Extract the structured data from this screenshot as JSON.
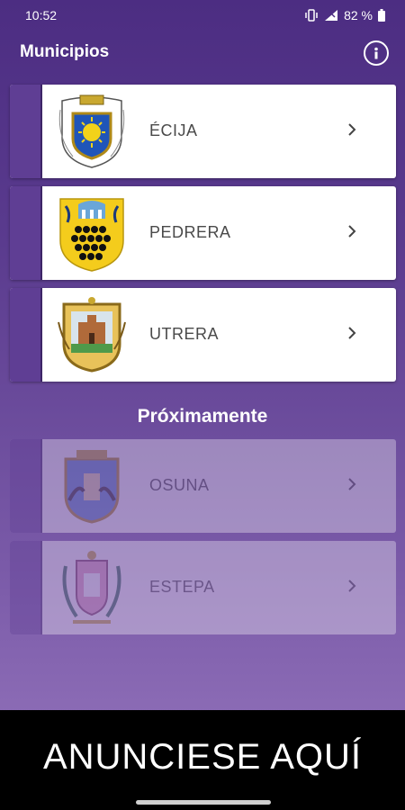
{
  "status_bar": {
    "time": "10:52",
    "battery": "82 %"
  },
  "header": {
    "title": "Municipios"
  },
  "municipalities": [
    {
      "name": "ÉCIJA"
    },
    {
      "name": "PEDRERA"
    },
    {
      "name": "UTRERA"
    }
  ],
  "coming_soon": {
    "title": "Próximamente",
    "items": [
      {
        "name": "OSUNA"
      },
      {
        "name": "ESTEPA"
      }
    ]
  },
  "ad": {
    "text": "ANUNCIESE AQUÍ"
  },
  "colors": {
    "accent": "#5f3e94",
    "background_top": "#4c2d82",
    "background_bottom": "#8b6bb5"
  }
}
